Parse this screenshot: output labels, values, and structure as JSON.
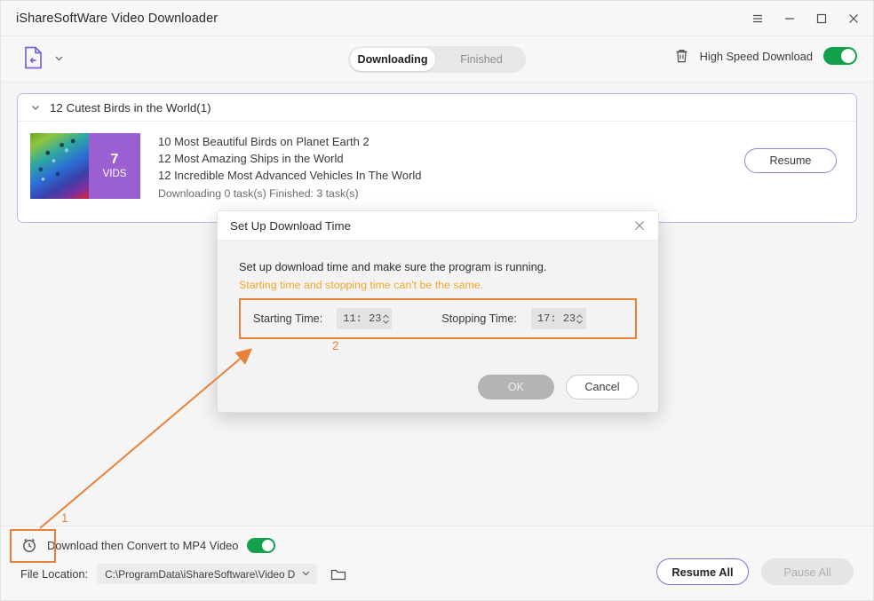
{
  "window": {
    "title": "iShareSoftWare Video Downloader",
    "controls": [
      {
        "name": "menu-icon",
        "label": "☰"
      },
      {
        "name": "minimize-icon",
        "label": "─"
      },
      {
        "name": "maximize-icon",
        "label": "□"
      },
      {
        "name": "close-icon",
        "label": "✕"
      }
    ]
  },
  "toolbar": {
    "paste_icon": "document-download-icon",
    "dropdown_icon": "chevron-down-icon",
    "tabs": [
      {
        "label": "Downloading",
        "active": true
      },
      {
        "label": "Finished",
        "active": false
      }
    ],
    "trash_icon": "trash-icon",
    "high_speed_label": "High Speed Download",
    "high_speed_enabled": "on",
    "toggle_color": "#13a04b"
  },
  "download_group": {
    "expand_icon": "chevron-down-icon",
    "title": "12 Cutest Birds in the World(1)",
    "thumbnail": {
      "count": "7",
      "unit": "VIDS",
      "badge_color": "#9a5fd0"
    },
    "videos": [
      "10 Most Beautiful Birds on Planet Earth 2",
      "12 Most Amazing Ships in the World",
      "12 Incredible Most Advanced Vehicles In The World"
    ],
    "status": "Downloading 0 task(s) Finished: 3 task(s)",
    "resume_button": "Resume",
    "border_color": "#c4aee8"
  },
  "dialog": {
    "title": "Set Up Download Time",
    "close_icon": "close-icon",
    "description": "Set up download time and make sure the program is running.",
    "warning": "Starting time and stopping time can't be the same.",
    "warning_color": "#f0a830",
    "starting": {
      "label": "Starting Time:",
      "value": "11: 23",
      "spinner_icon": "spinner-up-down-icon"
    },
    "stopping": {
      "label": "Stopping Time:",
      "value": "17: 23",
      "spinner_icon": "spinner-up-down-icon"
    },
    "ok_button": "OK",
    "ok_enabled": "false",
    "cancel_button": "Cancel"
  },
  "annotations": {
    "color": "#e8823a",
    "step_one": "1",
    "step_two": "2"
  },
  "bottom": {
    "clock_icon": "alarm-clock-icon",
    "convert_label": "Download then Convert to MP4 Video",
    "convert_enabled": "on",
    "file_location_label": "File Location:",
    "file_location_path": "C:\\ProgramData\\iShareSoftware\\Video Downlo",
    "path_dropdown_icon": "chevron-down-icon",
    "folder_icon": "folder-icon",
    "resume_all_button": "Resume All",
    "pause_all_button": "Pause All",
    "pause_all_enabled": "false"
  }
}
